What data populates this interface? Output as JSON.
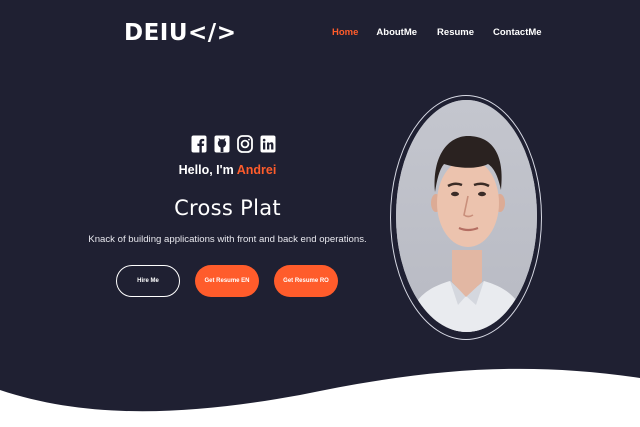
{
  "header": {
    "logo_text": "DEIU</>",
    "nav": [
      {
        "label": "Home",
        "active": true
      },
      {
        "label": "AboutMe",
        "active": false
      },
      {
        "label": "Resume",
        "active": false
      },
      {
        "label": "ContactMe",
        "active": false
      }
    ]
  },
  "hero": {
    "social_icons": [
      "facebook-icon",
      "github-icon",
      "instagram-icon",
      "linkedin-icon"
    ],
    "greeting_prefix": "Hello, I'm",
    "greeting_name": "Andrei",
    "role": "Cross Plat",
    "tagline": "Knack of building applications with front and back end operations.",
    "buttons": {
      "hire": "Hire Me",
      "resume_en": "Get Resume EN",
      "resume_ro": "Get Resume RO"
    }
  },
  "colors": {
    "background": "#1f2032",
    "accent": "#ff5c2b",
    "text": "#ffffff",
    "wave": "#ffffff"
  }
}
